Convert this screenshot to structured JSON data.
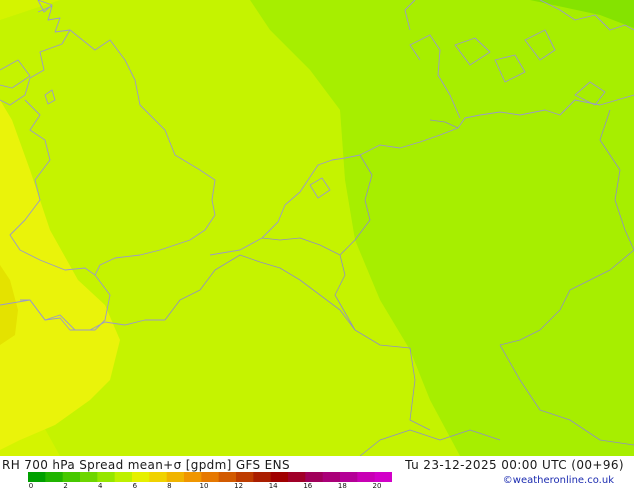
{
  "map": {
    "field_colors": {
      "outer_yellow": "#eaf30a",
      "inner_yellow": "#e4e200",
      "yellow_green": "#d4f400",
      "light_green": "#c5f300",
      "green": "#a7ee00",
      "dark_green": "#85e300"
    },
    "coastline_color": "#9a9ac8"
  },
  "footer": {
    "title": "RH 700 hPa Spread mean+σ [gpdm] GFS ENS",
    "valid_time": "Tu 23-12-2025 00:00 UTC (00+96)",
    "credit": "©weatheronline.co.uk",
    "colorbar": {
      "ticks": [
        "0",
        "2",
        "4",
        "6",
        "8",
        "10",
        "12",
        "14",
        "16",
        "18",
        "20"
      ],
      "colors": [
        "#00a000",
        "#20b400",
        "#46c800",
        "#6ed600",
        "#96e600",
        "#bef000",
        "#e6f000",
        "#f0d200",
        "#f0b400",
        "#f09600",
        "#e67800",
        "#d25a00",
        "#be3c00",
        "#aa1e00",
        "#a00000",
        "#a00028",
        "#a0005a",
        "#aa0078",
        "#b40096",
        "#c800b4",
        "#d200c8"
      ]
    }
  }
}
